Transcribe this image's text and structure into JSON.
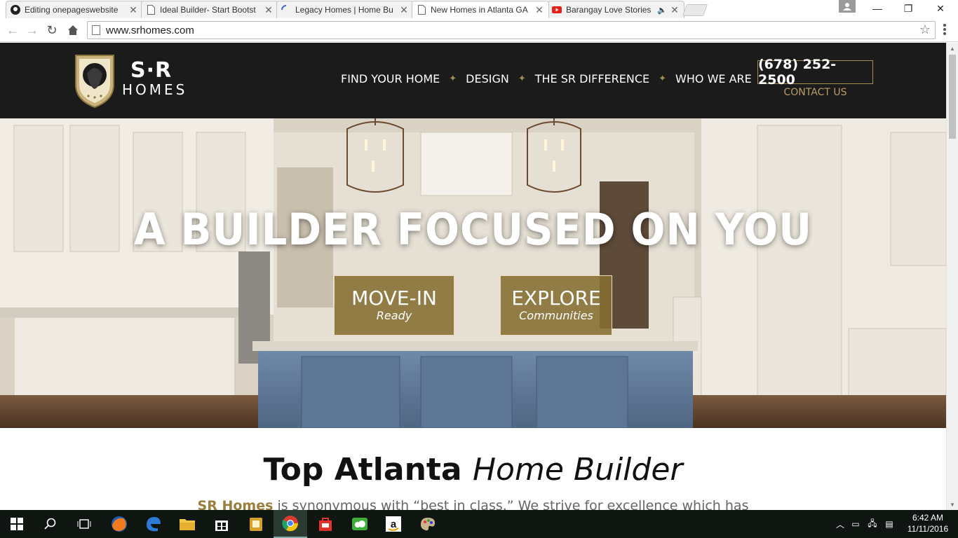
{
  "browser": {
    "tabs": [
      {
        "title": "Editing onepageswebsite",
        "icon": "github-icon"
      },
      {
        "title": "Ideal Builder- Start Bootst",
        "icon": "page-icon"
      },
      {
        "title": "Legacy Homes | Home Bu",
        "icon": "loading-icon"
      },
      {
        "title": "New Homes in Atlanta GA",
        "icon": "page-icon",
        "active": true
      },
      {
        "title": "Barangay Love Stories",
        "icon": "youtube-icon",
        "audio": true
      }
    ],
    "url": "www.srhomes.com"
  },
  "site": {
    "logo": {
      "sr": "S·R",
      "homes": "HOMES"
    },
    "nav": [
      "FIND YOUR HOME",
      "DESIGN",
      "THE SR DIFFERENCE",
      "WHO WE ARE"
    ],
    "phone": "(678) 252-2500",
    "contact": "CONTACT US",
    "hero": {
      "title": "A BUILDER FOCUSED ON YOU",
      "buttons": [
        {
          "big": "MOVE-IN",
          "small": "Ready"
        },
        {
          "big": "EXPLORE",
          "small": "Communities"
        }
      ]
    },
    "intro": {
      "title_bold": "Top Atlanta",
      "title_light": "Home Builder",
      "text_brand": "SR Homes",
      "text_rest": "is synonymous with “best in class.” We strive for excellence which has"
    }
  },
  "taskbar": {
    "time": "6:42 AM",
    "date": "11/11/2016"
  },
  "colors": {
    "header_bg": "#1b1b1b",
    "gold": "#a58b56",
    "button_bg": "#856d32"
  }
}
